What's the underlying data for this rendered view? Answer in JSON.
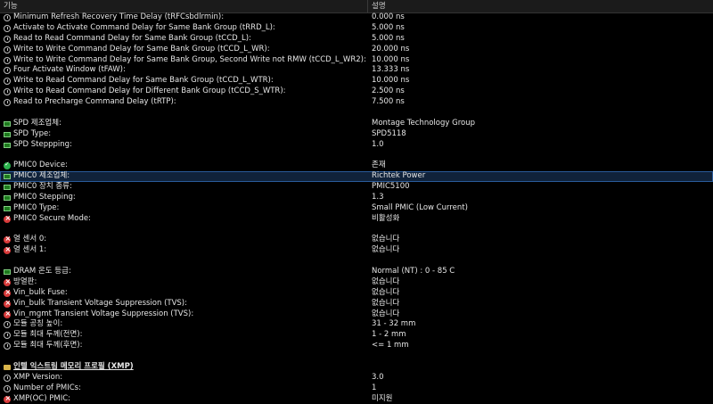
{
  "header": {
    "col_feature": "기능",
    "col_description": "설명"
  },
  "rows": [
    {
      "icon": "clock",
      "label": "Minimum Refresh Recovery Time Delay (tRFCsbdlrmin):",
      "value": "0.000 ns"
    },
    {
      "icon": "clock",
      "label": "Activate to Activate Command Delay for Same Bank Group (tRRD_L):",
      "value": "5.000 ns"
    },
    {
      "icon": "clock",
      "label": "Read to Read Command Delay for Same Bank Group (tCCD_L):",
      "value": "5.000 ns"
    },
    {
      "icon": "clock",
      "label": "Write to Write Command Delay for Same Bank Group (tCCD_L_WR):",
      "value": "20.000 ns"
    },
    {
      "icon": "clock",
      "label": "Write to Write Command Delay for Same Bank Group, Second Write not RMW (tCCD_L_WR2):",
      "value": "10.000 ns"
    },
    {
      "icon": "clock",
      "label": "Four Activate Window (tFAW):",
      "value": "13.333 ns"
    },
    {
      "icon": "clock",
      "label": "Write to Read Command Delay for Same Bank Group (tCCD_L_WTR):",
      "value": "10.000 ns"
    },
    {
      "icon": "clock",
      "label": "Write to Read Command Delay for Different Bank Group (tCCD_S_WTR):",
      "value": "2.500 ns"
    },
    {
      "icon": "clock",
      "label": "Read to Precharge Command Delay (tRTP):",
      "value": "7.500 ns"
    },
    {
      "icon": "",
      "label": "",
      "value": ""
    },
    {
      "icon": "ram",
      "label": "SPD 제조업체:",
      "value": "Montage Technology Group"
    },
    {
      "icon": "ram",
      "label": "SPD Type:",
      "value": "SPD5118"
    },
    {
      "icon": "ram",
      "label": "SPD Steppping:",
      "value": "1.0"
    },
    {
      "icon": "",
      "label": "",
      "value": ""
    },
    {
      "icon": "ok",
      "label": "PMIC0 Device:",
      "value": "존재"
    },
    {
      "icon": "ram",
      "label": "PMIC0 제조업체:",
      "value": "Richtek Power",
      "selected": true
    },
    {
      "icon": "ram",
      "label": "PMIC0 장치 종류:",
      "value": "PMIC5100"
    },
    {
      "icon": "ram",
      "label": "PMIC0 Stepping:",
      "value": "1.3"
    },
    {
      "icon": "ram",
      "label": "PMIC0 Type:",
      "value": "Small PMIC (Low Current)"
    },
    {
      "icon": "err",
      "label": "PMIC0 Secure Mode:",
      "value": "비활성화"
    },
    {
      "icon": "",
      "label": "",
      "value": ""
    },
    {
      "icon": "err",
      "label": "열 센서 0:",
      "value": "없습니다"
    },
    {
      "icon": "err",
      "label": "열 센서 1:",
      "value": "없습니다"
    },
    {
      "icon": "",
      "label": "",
      "value": ""
    },
    {
      "icon": "ram",
      "label": "DRAM 온도 등급:",
      "value": "Normal (NT) : 0 - 85 C"
    },
    {
      "icon": "err",
      "label": "방열판:",
      "value": "없습니다"
    },
    {
      "icon": "err",
      "label": "Vin_bulk Fuse:",
      "value": "없습니다"
    },
    {
      "icon": "err",
      "label": "Vin_bulk Transient Voltage Suppression (TVS):",
      "value": "없습니다"
    },
    {
      "icon": "err",
      "label": "Vin_mgmt Transient Voltage Suppression (TVS):",
      "value": "없습니다"
    },
    {
      "icon": "clock",
      "label": "모듈 공칭 높이:",
      "value": "31 - 32 mm"
    },
    {
      "icon": "clock",
      "label": "모듈 최대 두께(전면):",
      "value": "1 - 2 mm"
    },
    {
      "icon": "clock",
      "label": "모듈 최대 두께(후면):",
      "value": "<= 1 mm"
    },
    {
      "icon": "",
      "label": "",
      "value": ""
    },
    {
      "icon": "folder",
      "label": "인텔 익스트림 메모리 프로필 (XMP)",
      "value": "",
      "group": true
    },
    {
      "icon": "clock",
      "label": "XMP Version:",
      "value": "3.0"
    },
    {
      "icon": "clock",
      "label": "Number of PMICs:",
      "value": "1"
    },
    {
      "icon": "err",
      "label": "XMP(OC) PMIC:",
      "value": "미지원"
    }
  ]
}
